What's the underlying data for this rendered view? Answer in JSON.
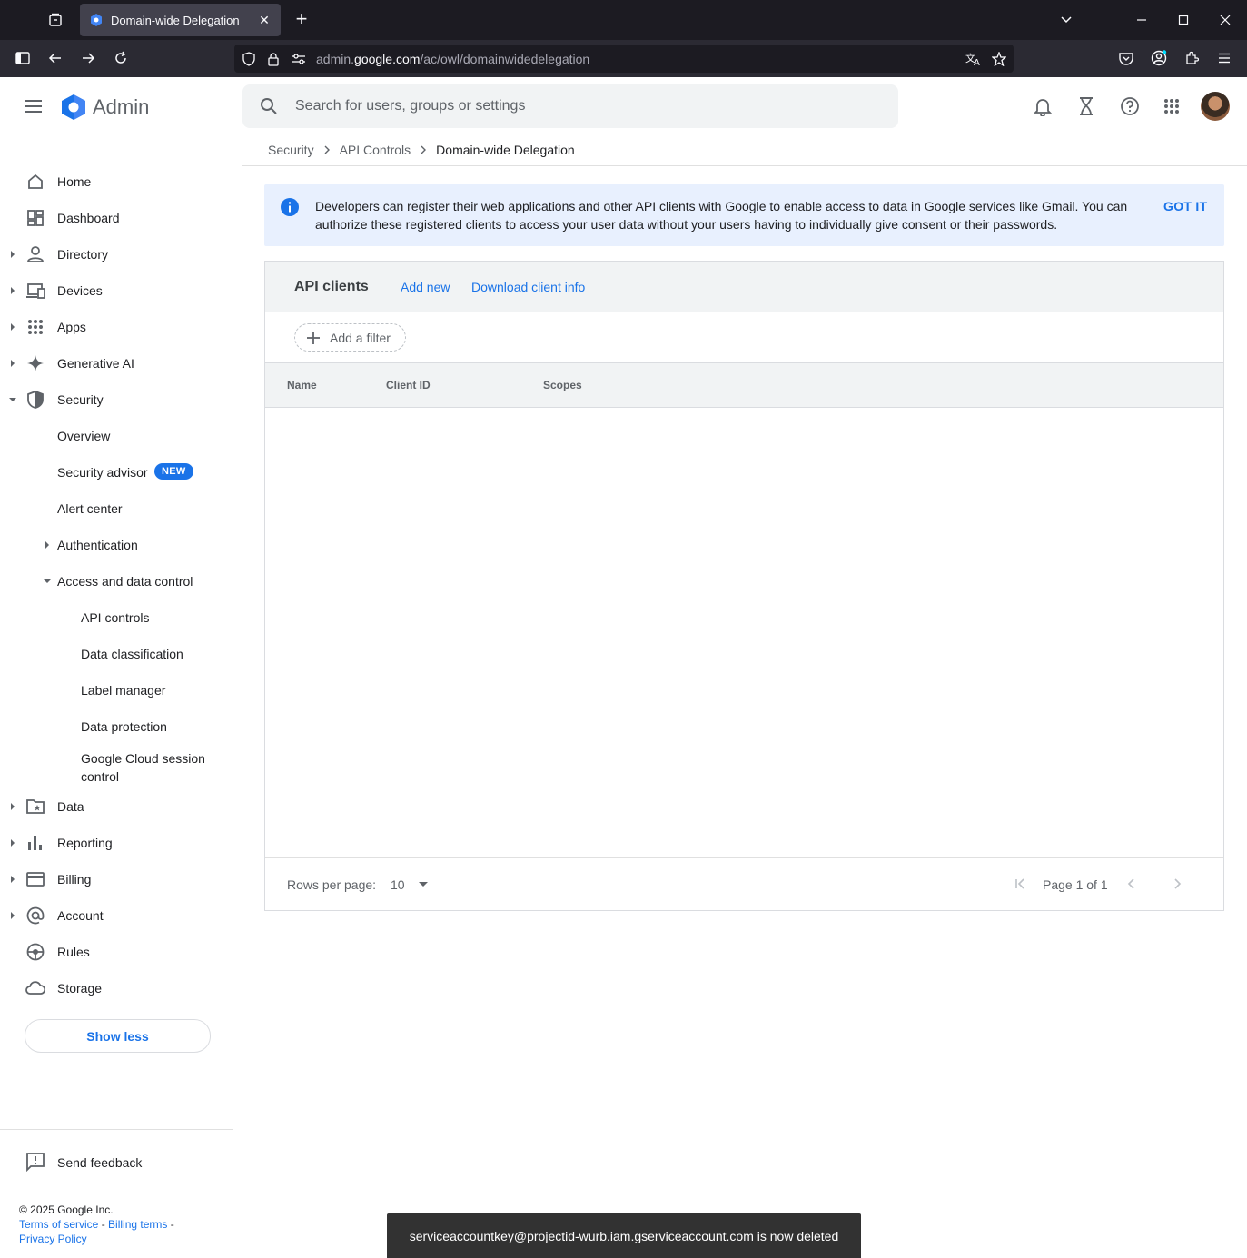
{
  "browser": {
    "tab_title": "Domain-wide Delegation",
    "url_host_prefix": "admin.",
    "url_host": "google.com",
    "url_path": "/ac/owl/domainwidedelegation"
  },
  "header": {
    "app_name": "Admin",
    "search_placeholder": "Search for users, groups or settings"
  },
  "sidebar": {
    "items": [
      {
        "label": "Home"
      },
      {
        "label": "Dashboard"
      },
      {
        "label": "Directory"
      },
      {
        "label": "Devices"
      },
      {
        "label": "Apps"
      },
      {
        "label": "Generative AI"
      },
      {
        "label": "Security"
      },
      {
        "label": "Overview"
      },
      {
        "label": "Security advisor",
        "badge": "NEW"
      },
      {
        "label": "Alert center"
      },
      {
        "label": "Authentication"
      },
      {
        "label": "Access and data control"
      },
      {
        "label": "API controls"
      },
      {
        "label": "Data classification"
      },
      {
        "label": "Label manager"
      },
      {
        "label": "Data protection"
      },
      {
        "label": "Google Cloud session control"
      },
      {
        "label": "Data"
      },
      {
        "label": "Reporting"
      },
      {
        "label": "Billing"
      },
      {
        "label": "Account"
      },
      {
        "label": "Rules"
      },
      {
        "label": "Storage"
      }
    ],
    "gcsc_line1": "Google Cloud session",
    "gcsc_line2": "control",
    "show_less": "Show less",
    "send_feedback": "Send feedback",
    "footer": {
      "copyright": "© 2025 Google Inc.",
      "terms": "Terms of service",
      "sep1": " - ",
      "billing_terms": "Billing terms",
      "sep2": " -",
      "privacy": "Privacy Policy"
    }
  },
  "breadcrumb": {
    "items": [
      "Security",
      "API Controls",
      "Domain-wide Delegation"
    ],
    "sep": ">"
  },
  "banner": {
    "text": "Developers can register their web applications and other API clients with Google to enable access to data in Google services like Gmail. You can authorize these registered clients to access your user data without your users having to individually give consent or their passwords.",
    "action": "GOT IT"
  },
  "api_clients": {
    "title": "API clients",
    "add_new": "Add new",
    "download": "Download client info",
    "add_filter": "Add a filter",
    "columns": [
      "Name",
      "Client ID",
      "Scopes"
    ],
    "rows_per_page_label": "Rows per page:",
    "rows_per_page_value": "10",
    "page_text": "Page 1 of 1"
  },
  "snackbar": {
    "text": "serviceaccountkey@projectid-wurb.iam.gserviceaccount.com is now deleted"
  },
  "colors": {
    "accent": "#1a73e8",
    "banner_bg": "#e8f0fe",
    "browser_dark": "#1c1b22"
  }
}
